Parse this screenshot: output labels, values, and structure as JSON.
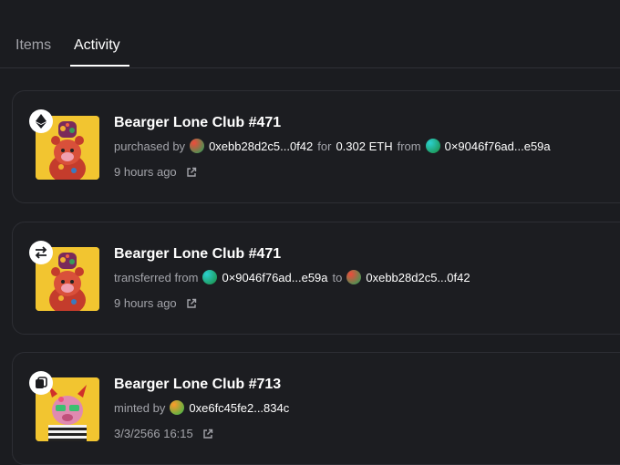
{
  "tabs": {
    "items_label": "Items",
    "activity_label": "Activity"
  },
  "activities": [
    {
      "type_icon": "ethereum-icon",
      "title": "Bearger Lone Club #471",
      "verb": "purchased by",
      "addr1": "0xebb28d2c5...0f42",
      "for_word": "for",
      "amount": "0.302 ETH",
      "from_word": "from",
      "addr2": "0×9046f76ad...e59a",
      "time": "9 hours ago"
    },
    {
      "type_icon": "transfer-icon",
      "title": "Bearger Lone Club #471",
      "verb": "transferred from",
      "addr1": "0×9046f76ad...e59a",
      "to_word": "to",
      "addr2": "0xebb28d2c5...0f42",
      "time": "9 hours ago"
    },
    {
      "type_icon": "mint-icon",
      "title": "Bearger Lone Club #713",
      "verb": "minted by",
      "addr1": "0xe6fc45fe2...834c",
      "time": "3/3/2566 16:15"
    }
  ]
}
